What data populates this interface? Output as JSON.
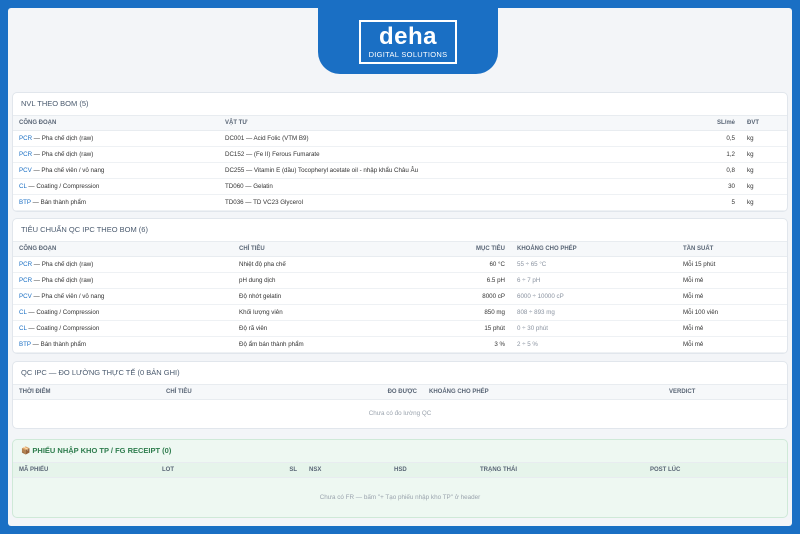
{
  "brand": {
    "name": "deha",
    "tagline": "DIGITAL SOLUTIONS"
  },
  "nvl": {
    "title": "NVL THEO BOM (5)",
    "headers": [
      "CÔNG ĐOẠN",
      "VẬT TƯ",
      "SL/mẻ",
      "ĐVT"
    ],
    "rows": [
      {
        "code": "PCR",
        "stage": "Pha chế dịch (raw)",
        "material": "DC001 — Acid Folic (VTM B9)",
        "qty": "0,5",
        "unit": "kg"
      },
      {
        "code": "PCR",
        "stage": "Pha chế dịch (raw)",
        "material": "DC152 — (Fe II) Ferous Fumarate",
        "qty": "1,2",
        "unit": "kg"
      },
      {
        "code": "PCV",
        "stage": "Pha chế viên / vỏ nang",
        "material": "DC255 — Vitamin E (dầu) Tocopheryl acetate oil - nhập khẩu Châu Âu",
        "qty": "0,8",
        "unit": "kg"
      },
      {
        "code": "CL",
        "stage": "Coating / Compression",
        "material": "TD060 — Gelatin",
        "qty": "30",
        "unit": "kg"
      },
      {
        "code": "BTP",
        "stage": "Bán thành phẩm",
        "material": "TD036 — TD VC23 Glycerol",
        "qty": "5",
        "unit": "kg"
      }
    ]
  },
  "ipc_std": {
    "title": "TIÊU CHUẨN QC IPC THEO BOM (6)",
    "headers": [
      "CÔNG ĐOẠN",
      "CHỈ TIÊU",
      "MỤC TIÊU",
      "KHOẢNG CHO PHÉP",
      "TẦN SUẤT"
    ],
    "rows": [
      {
        "code": "PCR",
        "stage": "Pha chế dịch (raw)",
        "metric": "Nhiệt độ pha chế",
        "target": "60 °C",
        "range": "55 ÷ 65 °C",
        "freq": "Mỗi 15 phút"
      },
      {
        "code": "PCR",
        "stage": "Pha chế dịch (raw)",
        "metric": "pH dung dịch",
        "target": "6.5 pH",
        "range": "6 ÷ 7 pH",
        "freq": "Mỗi mẻ"
      },
      {
        "code": "PCV",
        "stage": "Pha chế viên / vỏ nang",
        "metric": "Độ nhớt gelatin",
        "target": "8000 cP",
        "range": "6000 ÷ 10000 cP",
        "freq": "Mỗi mẻ"
      },
      {
        "code": "CL",
        "stage": "Coating / Compression",
        "metric": "Khối lượng viên",
        "target": "850 mg",
        "range": "808 ÷ 893 mg",
        "freq": "Mỗi 100 viên"
      },
      {
        "code": "CL",
        "stage": "Coating / Compression",
        "metric": "Độ rã viên",
        "target": "15 phút",
        "range": "0 ÷ 30 phút",
        "freq": "Mỗi mẻ"
      },
      {
        "code": "BTP",
        "stage": "Bán thành phẩm",
        "metric": "Độ ẩm bán thành phẩm",
        "target": "3 %",
        "range": "2 ÷ 5 %",
        "freq": "Mỗi mẻ"
      }
    ]
  },
  "qc_actual": {
    "title": "QC IPC — ĐO LƯỜNG THỰC TẾ (0 BẢN GHI)",
    "headers": [
      "THỜI ĐIỂM",
      "CHỈ TIÊU",
      "ĐO ĐƯỢC",
      "KHOẢNG CHO PHÉP",
      "VERDICT"
    ],
    "empty": "Chưa có đo lường QC"
  },
  "fg_receipt": {
    "title": "📦 PHIẾU NHẬP KHO TP / FG RECEIPT (0)",
    "headers": [
      "MÃ PHIẾU",
      "LOT",
      "SL",
      "NSX",
      "HSD",
      "TRẠNG THÁI",
      "POST LÚC"
    ],
    "empty": "Chưa có FR — bấm \"+ Tạo phiếu nhập kho TP\" ở header"
  }
}
